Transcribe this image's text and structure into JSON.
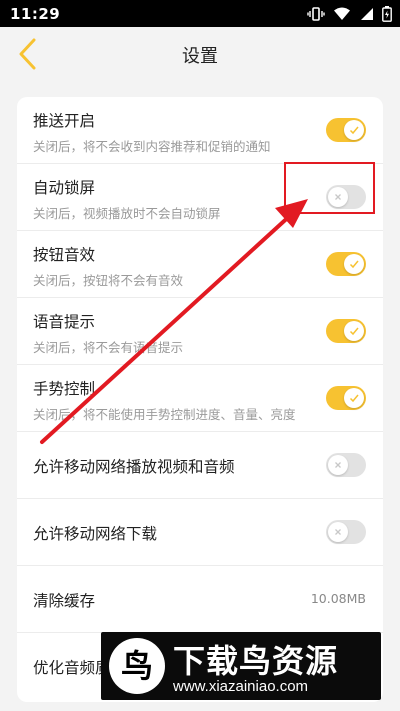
{
  "status_bar": {
    "time": "11:29",
    "icons": [
      "vibrate-icon",
      "wifi-icon",
      "signal-icon",
      "battery-icon"
    ]
  },
  "header": {
    "title": "设置",
    "back_icon": "chevron-left-icon",
    "accent_color": "#f7c231"
  },
  "settings": [
    {
      "title": "推送开启",
      "desc": "关闭后，将不会收到内容推荐和促销的通知",
      "toggle": true
    },
    {
      "title": "自动锁屏",
      "desc": "关闭后，视频播放时不会自动锁屏",
      "toggle": false
    },
    {
      "title": "按钮音效",
      "desc": "关闭后，按钮将不会有音效",
      "toggle": true
    },
    {
      "title": "语音提示",
      "desc": "关闭后，将不会有语音提示",
      "toggle": true
    },
    {
      "title": "手势控制",
      "desc": "关闭后，将不能使用手势控制进度、音量、亮度",
      "toggle": true
    },
    {
      "title": "允许移动网络播放视频和音频",
      "toggle": false
    },
    {
      "title": "允许移动网络下载",
      "toggle": false
    },
    {
      "title": "清除缓存",
      "value": "10.08MB"
    },
    {
      "title": "优化音频质"
    }
  ],
  "annotation": {
    "color": "#e21a22"
  },
  "watermark": {
    "logo_char": "鸟",
    "title": "下载鸟资源",
    "url": "www.xiazainiao.com"
  }
}
